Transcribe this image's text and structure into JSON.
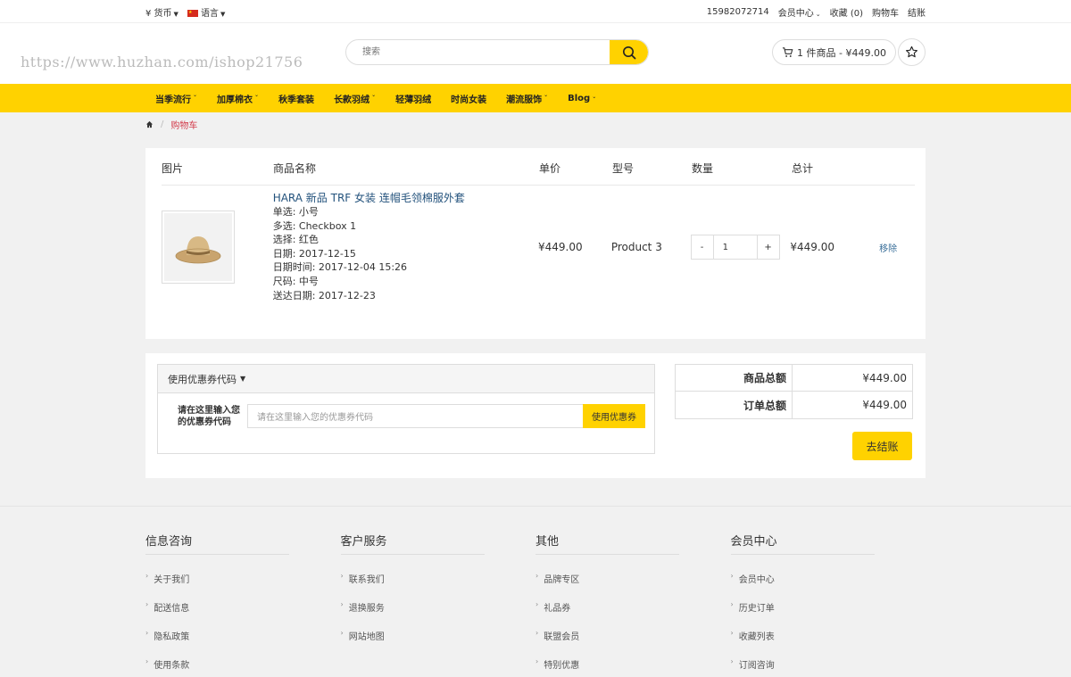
{
  "topbar": {
    "currency": "¥ 货币",
    "language": "语言",
    "phone": "15982072714",
    "account": "会员中心",
    "wishlist": "收藏 (0)",
    "cart": "购物车",
    "checkout": "结账"
  },
  "header": {
    "watermark": "https://www.huzhan.com/ishop21756",
    "search_placeholder": "搜索",
    "cart_summary": "1 件商品 - ¥449.00"
  },
  "nav": [
    {
      "label": "当季流行",
      "dropdown": true
    },
    {
      "label": "加厚棉衣",
      "dropdown": true
    },
    {
      "label": "秋季套装",
      "dropdown": false
    },
    {
      "label": "长款羽绒",
      "dropdown": true
    },
    {
      "label": "轻薄羽绒",
      "dropdown": false
    },
    {
      "label": "时尚女装",
      "dropdown": false
    },
    {
      "label": "潮流服饰",
      "dropdown": true
    },
    {
      "label": "Blog",
      "dropdown": true
    }
  ],
  "breadcrumb": {
    "current": "购物车"
  },
  "cart": {
    "headers": {
      "image": "图片",
      "name": "商品名称",
      "price": "单价",
      "model": "型号",
      "qty": "数量",
      "total": "总计"
    },
    "item": {
      "name": "HARA 新品 TRF 女装 连帽毛领棉服外套",
      "options": [
        "单选: 小号",
        "多选: Checkbox 1",
        "选择: 红色",
        "日期: 2017-12-15",
        "日期时间: 2017-12-04 15:26",
        "尺码: 中号",
        "送达日期: 2017-12-23"
      ],
      "price": "¥449.00",
      "model": "Product 3",
      "qty": "1",
      "minus": "-",
      "plus": "+",
      "total": "¥449.00",
      "remove": "移除"
    }
  },
  "coupon": {
    "toggle": "使用优惠券代码",
    "label": "请在这里输入您的优惠券代码",
    "placeholder": "请在这里输入您的优惠券代码",
    "button": "使用优惠券"
  },
  "totals": {
    "subtotal_label": "商品总额",
    "subtotal": "¥449.00",
    "total_label": "订单总额",
    "total": "¥449.00",
    "checkout": "去结账"
  },
  "footer": [
    {
      "title": "信息咨询",
      "links": [
        "关于我们",
        "配送信息",
        "隐私政策",
        "使用条款"
      ]
    },
    {
      "title": "客户服务",
      "links": [
        "联系我们",
        "退换服务",
        "网站地图"
      ]
    },
    {
      "title": "其他",
      "links": [
        "品牌专区",
        "礼品券",
        "联盟会员",
        "特别优惠"
      ]
    },
    {
      "title": "会员中心",
      "links": [
        "会员中心",
        "历史订单",
        "收藏列表",
        "订阅咨询"
      ]
    }
  ],
  "colors": {
    "accent": "#ffd200",
    "link": "#23527c",
    "breadcrumb_active": "#d23a4a"
  }
}
